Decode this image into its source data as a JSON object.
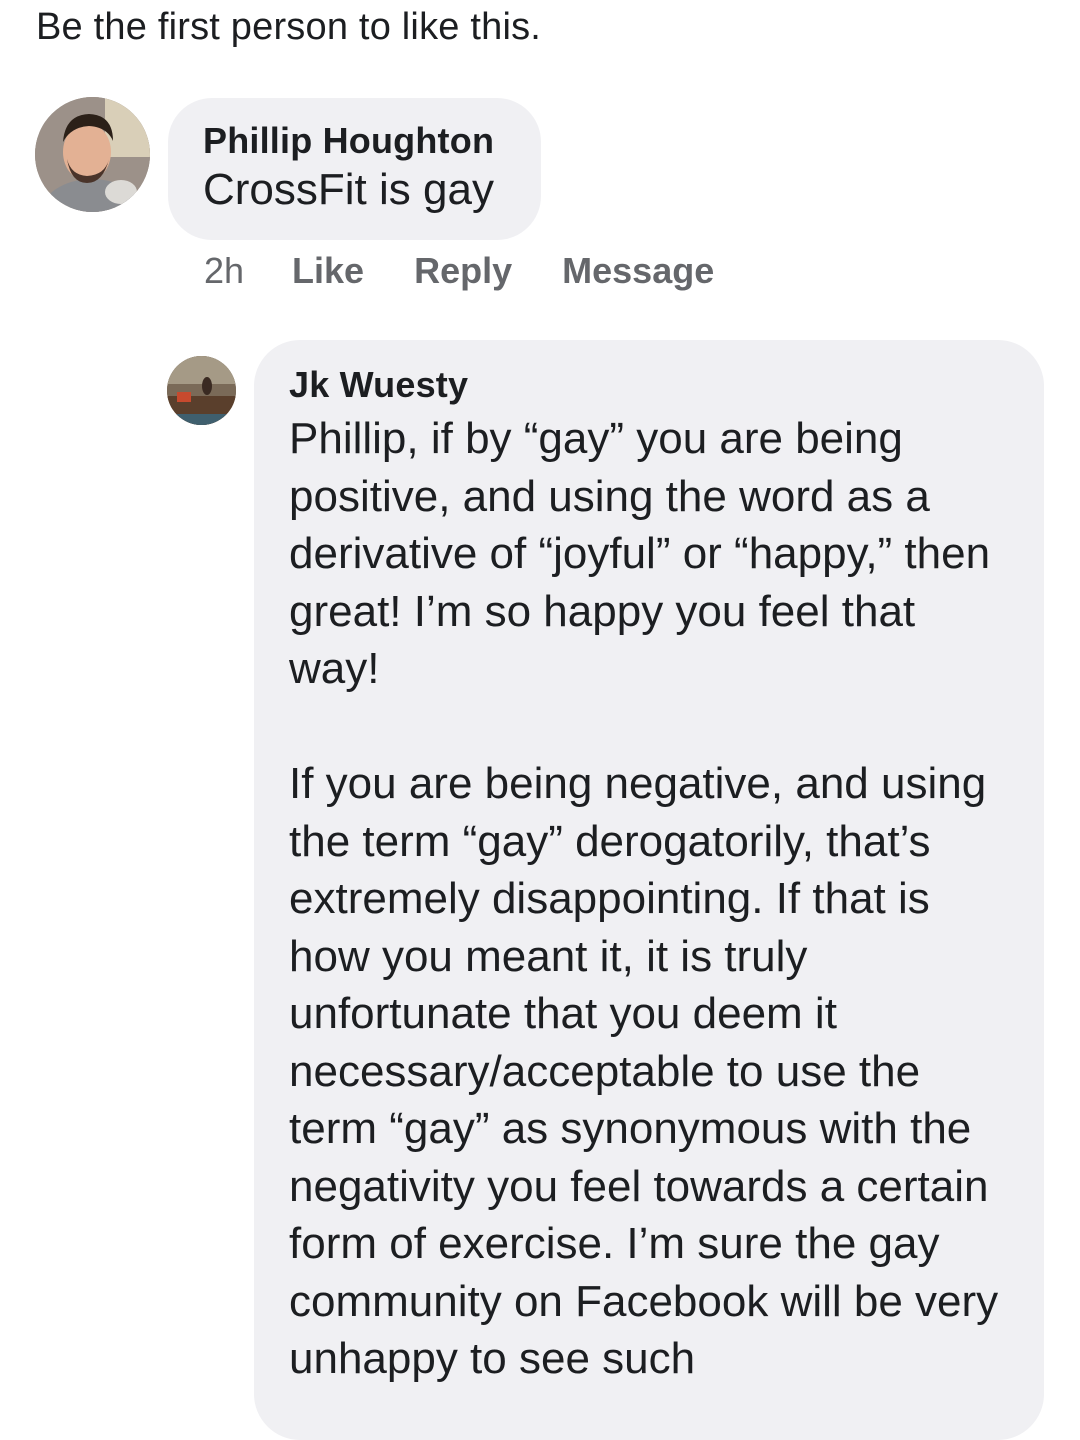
{
  "likes_summary": "Be the first person to like this.",
  "comments": [
    {
      "author": "Phillip Houghton",
      "text": "CrossFit is gay",
      "time": "2h",
      "actions": [
        "Like",
        "Reply",
        "Message"
      ]
    },
    {
      "author": "Jk Wuesty",
      "paragraphs": [
        "Phillip, if by “gay” you are being positive, and using the word as a derivative of “joyful” or “happy,” then great! I’m so happy you feel that way!",
        "If you are being negative, and using the term “gay” derogatorily, that’s extremely disappointing. If that is how you meant it, it is truly unfortunate that you deem it necessary/acceptable to use the term “gay” as synonymous with the negativity you feel towards a certain form of exercise. I’m sure the gay community on Facebook will be very unhappy to see such"
      ]
    }
  ],
  "colors": {
    "bubble": "#f0f0f3",
    "text": "#1c1e21",
    "secondary_text": "#65676b"
  }
}
